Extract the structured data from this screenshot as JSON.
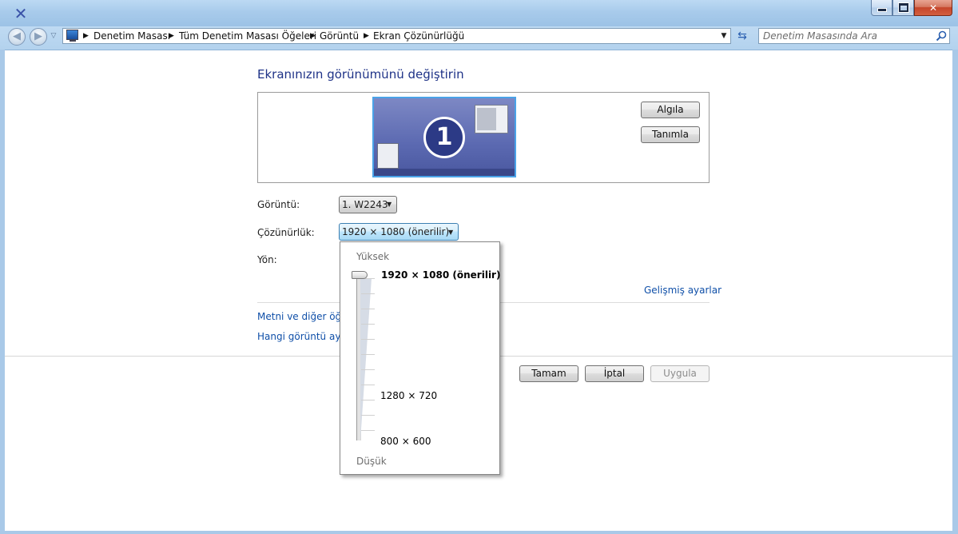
{
  "window": {
    "controls": {
      "minimize": "minimize",
      "maximize": "maximize",
      "close": "close"
    }
  },
  "navigation": {
    "back_icon": "back-arrow-icon",
    "forward_icon": "forward-arrow-icon",
    "recent_icon": "chevron-down-icon",
    "breadcrumbs": [
      "Denetim Masası",
      "Tüm Denetim Masası Öğeleri",
      "Görüntü",
      "Ekran Çözünürlüğü"
    ],
    "search_placeholder": "Denetim Masasında Ara"
  },
  "main": {
    "title": "Ekranınızın görünümünü değiştirin",
    "monitor_number": "1",
    "detect_label": "Algıla",
    "identify_label": "Tanımla",
    "display_label": "Görüntü:",
    "display_value": "1. W2243",
    "resolution_label": "Çözünürlük:",
    "resolution_value": "1920 × 1080 (önerilir)",
    "orientation_label": "Yön:",
    "advanced_link": "Gelişmiş ayarlar",
    "text_size_link": "Metni ve diğer öğel",
    "which_settings_link": "Hangi görüntü ayar",
    "ok_label": "Tamam",
    "cancel_label": "İptal",
    "apply_label": "Uygula",
    "apply_enabled": false
  },
  "resolution_dropdown": {
    "high_label": "Yüksek",
    "low_label": "Düşük",
    "options": [
      "1920 × 1080 (önerilir)",
      "1280 × 720",
      "800 × 600"
    ],
    "selected_index": 0
  },
  "colors": {
    "title": "#1e3287",
    "link": "#0f4fa8",
    "selection_border": "#3c7fb1",
    "monitor_bg": "#5b69b1"
  }
}
